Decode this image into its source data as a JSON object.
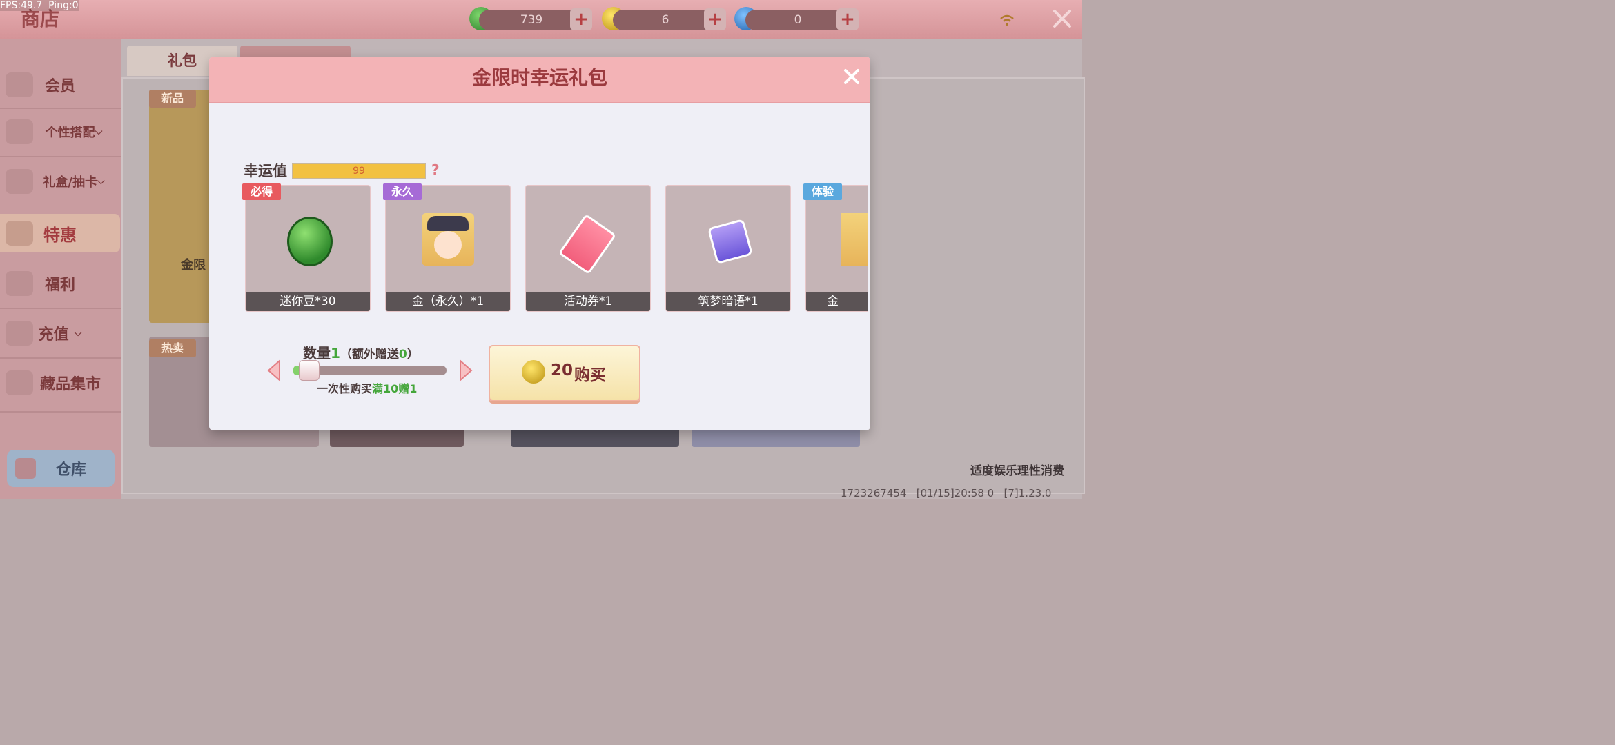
{
  "debug": {
    "fps_text": "FPS:49.7  Ping:0"
  },
  "header": {
    "title": "商店"
  },
  "currencies": [
    {
      "name": "mini-bean",
      "value": "739",
      "color": "#3c9a3a"
    },
    {
      "name": "gold-coin",
      "value": "6",
      "color": "#e7c42b"
    },
    {
      "name": "blue-coin",
      "value": "0",
      "color": "#2d73c8"
    }
  ],
  "sidebar": {
    "items": [
      {
        "label": "会员"
      },
      {
        "label": "个性搭配"
      },
      {
        "label": "礼盒/抽卡"
      },
      {
        "label": "特惠"
      },
      {
        "label": "福利"
      },
      {
        "label": "充值"
      },
      {
        "label": "藏品集市"
      }
    ],
    "warehouse": "仓库"
  },
  "tabs": [
    {
      "label": "礼包"
    }
  ],
  "shop": {
    "tag_new": "新品",
    "tag_hot": "热卖",
    "card_text": "金限"
  },
  "footer": {
    "notice": "适度娱乐理性消费",
    "build_info": "1723267454   [01/15]20:58 0   [7]1.23.0"
  },
  "modal": {
    "title": "金限时幸运礼包",
    "luck": {
      "label": "幸运值",
      "value": "99",
      "fill_fraction": 1.0,
      "help": "?"
    },
    "items": [
      {
        "tag": "必得",
        "tag_color": "#e85a5f",
        "label": "迷你豆*30",
        "icon": "mini-bean-icon"
      },
      {
        "tag": "永久",
        "tag_color": "#a66bd6",
        "label": "金（永久）*1",
        "icon": "character-portrait-icon"
      },
      {
        "tag": "",
        "tag_color": "",
        "label": "活动券*1",
        "icon": "event-ticket-icon"
      },
      {
        "tag": "",
        "tag_color": "",
        "label": "筑梦暗语*1",
        "icon": "dream-whisper-icon"
      },
      {
        "tag": "体验",
        "tag_color": "#5aa8de",
        "label": "金",
        "icon": "character-trial-icon"
      }
    ],
    "quantity": {
      "label": "数量",
      "value": "1",
      "bonus_prefix": "（额外赠送",
      "bonus_value": "0",
      "bonus_suffix": "）",
      "slider_fraction": 0.0,
      "promo_prefix": "一次性购买",
      "promo_highlight": "满10赠1"
    },
    "buy": {
      "price": "20",
      "label": "购买"
    }
  }
}
